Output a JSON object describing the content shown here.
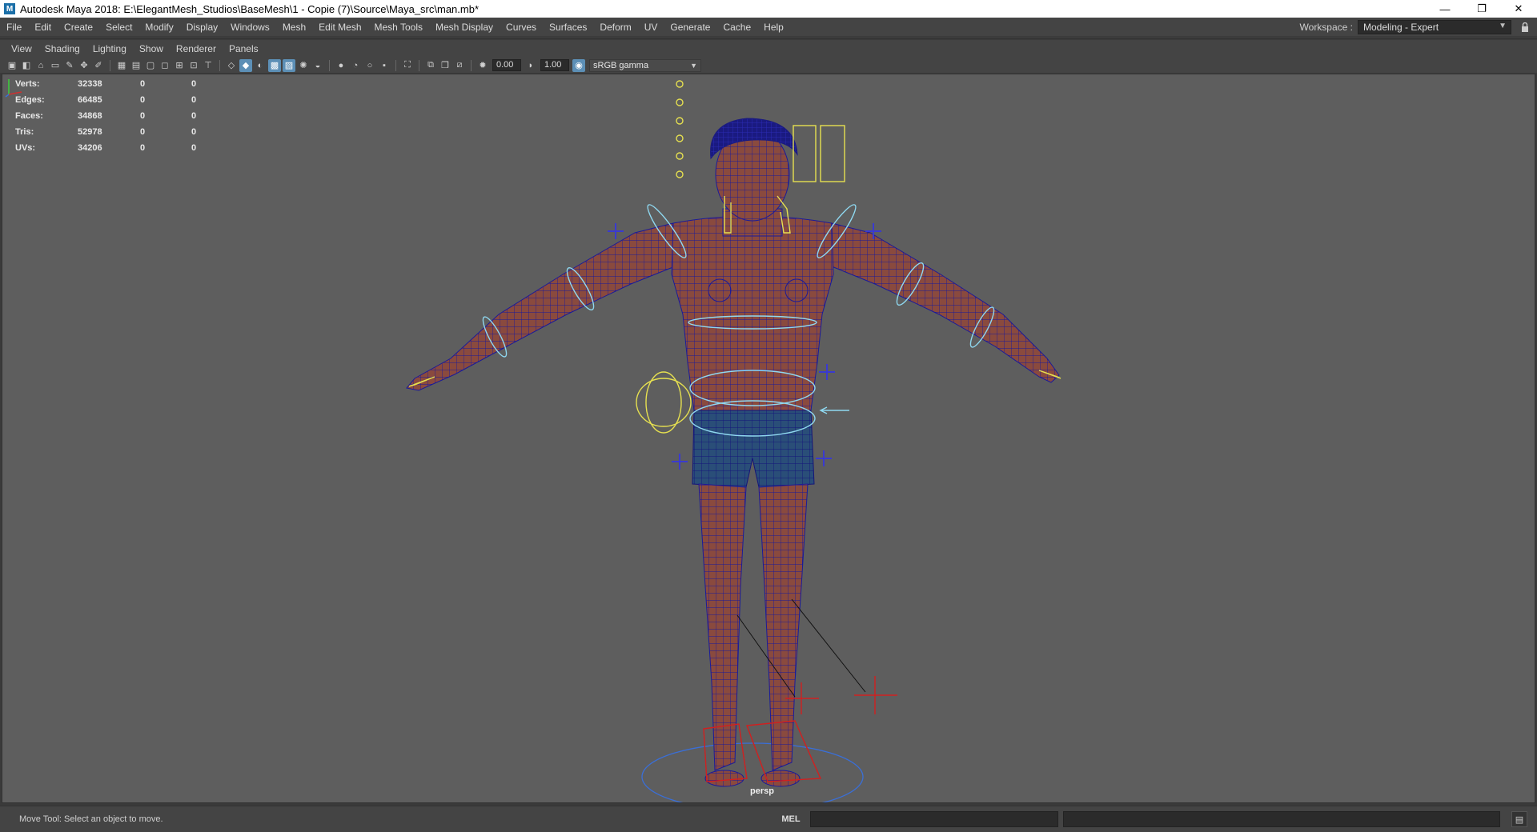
{
  "window": {
    "title": "Autodesk Maya 2018: E:\\ElegantMesh_Studios\\BaseMesh\\1 - Copie (7)\\Source\\Maya_src\\man.mb*",
    "app_icon": "M",
    "minimize_glyph": "—",
    "restore_glyph": "❐",
    "close_glyph": "✕"
  },
  "menubar": {
    "items": [
      "File",
      "Edit",
      "Create",
      "Select",
      "Modify",
      "Display",
      "Windows",
      "Mesh",
      "Edit Mesh",
      "Mesh Tools",
      "Mesh Display",
      "Curves",
      "Surfaces",
      "Deform",
      "UV",
      "Generate",
      "Cache",
      "Help"
    ],
    "workspace_label": "Workspace :",
    "workspace_value": "Modeling - Expert",
    "lock_icon": "lock-icon"
  },
  "panel_menu": {
    "items": [
      "View",
      "Shading",
      "Lighting",
      "Show",
      "Renderer",
      "Panels"
    ]
  },
  "toolbar": {
    "exposure": "0.00",
    "gamma": "1.00",
    "color_space": "sRGB gamma"
  },
  "hud": {
    "rows": [
      {
        "label": "Verts:",
        "value": "32338",
        "selected": "0",
        "uv": "0"
      },
      {
        "label": "Edges:",
        "value": "66485",
        "selected": "0",
        "uv": "0"
      },
      {
        "label": "Faces:",
        "value": "34868",
        "selected": "0",
        "uv": "0"
      },
      {
        "label": "Tris:",
        "value": "52978",
        "selected": "0",
        "uv": "0"
      },
      {
        "label": "UVs:",
        "value": "34206",
        "selected": "0",
        "uv": "0"
      }
    ]
  },
  "viewport": {
    "camera": "persp",
    "background_color": "#5e5e5e",
    "mesh_color": "#8a4a3e",
    "wire_color": "#1a1a9a",
    "control_color_cyan": "#8fd8f0",
    "control_color_yellow": "#e6e050",
    "control_color_blue": "#3a3ad0",
    "control_color_red": "#d02020"
  },
  "statusbar": {
    "help_line": "Move Tool: Select an object to move.",
    "mel_label": "MEL"
  }
}
